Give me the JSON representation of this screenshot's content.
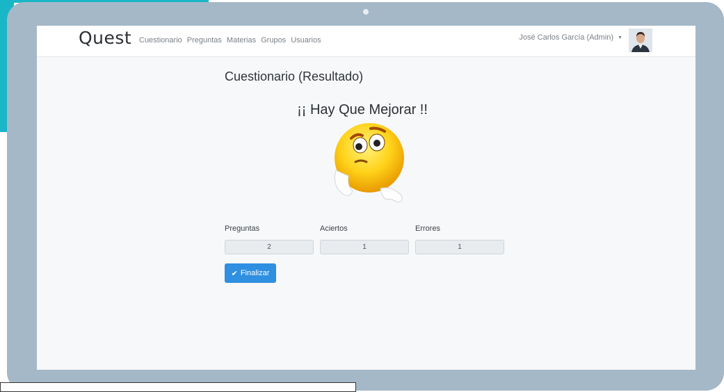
{
  "navbar": {
    "brand": "Quest",
    "links": [
      "Cuestionario",
      "Preguntas",
      "Materias",
      "Grupos",
      "Usuarios"
    ],
    "user": "José Carlos García (Admin)"
  },
  "page": {
    "title": "Cuestionario (Resultado)",
    "result_heading": "¡¡ Hay Que Mejorar !!"
  },
  "stats": [
    {
      "label": "Preguntas",
      "value": "2"
    },
    {
      "label": "Aciertos",
      "value": "1"
    },
    {
      "label": "Errores",
      "value": "1"
    }
  ],
  "actions": {
    "finalizar_label": "Finalizar"
  },
  "colors": {
    "primary": "#2f8fe0",
    "accent_teal": "#19b6c8",
    "laptop_frame": "#a5b8c7"
  },
  "icons": {
    "finalizar": "check-icon",
    "emoji": "thinking-emoji-icon"
  }
}
